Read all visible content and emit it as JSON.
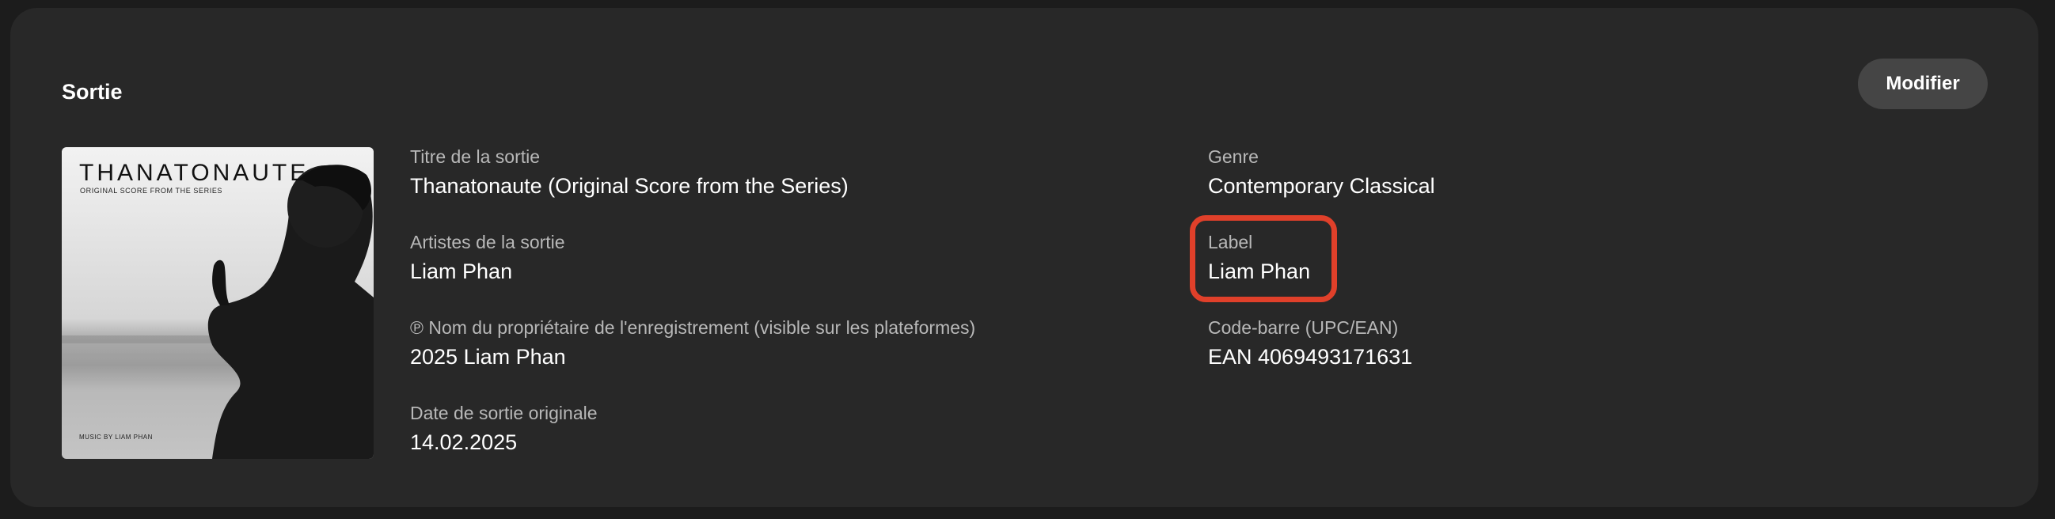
{
  "section": {
    "title": "Sortie",
    "edit_label": "Modifier"
  },
  "cover": {
    "title": "THANATONAUTE",
    "subtitle": "ORIGINAL SCORE FROM THE SERIES",
    "credit": "MUSIC BY LIAM PHAN"
  },
  "fields": {
    "release_title": {
      "label": "Titre de la sortie",
      "value": "Thanatonaute (Original Score from the Series)"
    },
    "release_artists": {
      "label": "Artistes de la sortie",
      "value": "Liam Phan"
    },
    "recording_owner": {
      "label": "℗ Nom du propriétaire de l'enregistrement (visible sur les plateformes)",
      "value": "2025 Liam Phan"
    },
    "original_release_date": {
      "label": "Date de sortie originale",
      "value": "14.02.2025"
    },
    "genre": {
      "label": "Genre",
      "value": "Contemporary Classical"
    },
    "record_label": {
      "label": "Label",
      "value": "Liam Phan"
    },
    "barcode": {
      "label": "Code-barre (UPC/EAN)",
      "value": "EAN 4069493171631"
    }
  },
  "colors": {
    "card_background": "#282828",
    "button_background": "#454545",
    "highlight_border": "#e0402a"
  }
}
